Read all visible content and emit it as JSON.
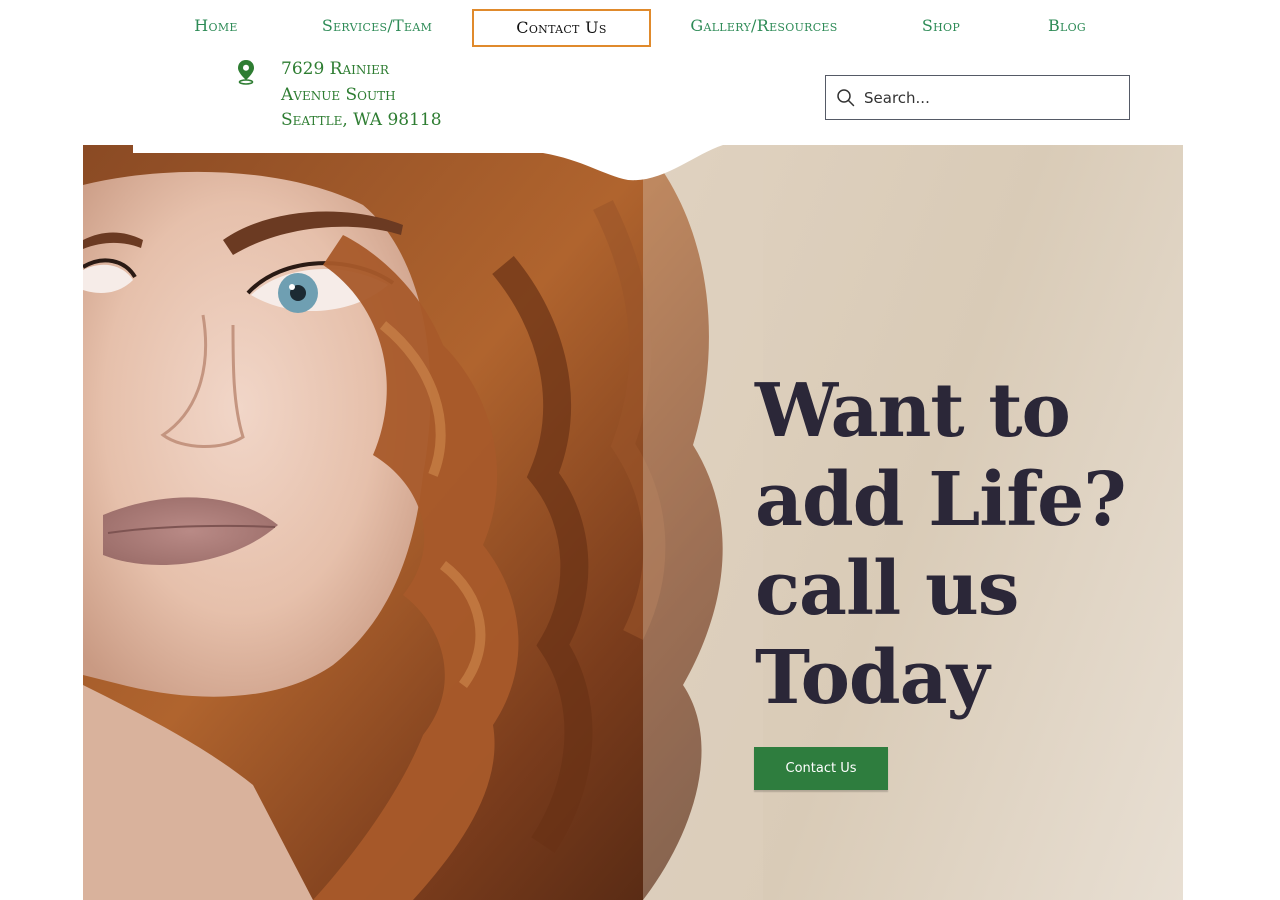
{
  "nav": {
    "items": [
      {
        "label": "Home"
      },
      {
        "label": "Services/Team"
      },
      {
        "label": "Contact Us"
      },
      {
        "label": "Gallery/Resources"
      },
      {
        "label": "Shop"
      },
      {
        "label": "Blog"
      }
    ],
    "active_index": 2,
    "text_color": "#2e8b57",
    "active_border_color": "#e08a2c"
  },
  "address": {
    "icon": "map-pin-icon",
    "lines": [
      "7629 Rainier",
      "Avenue South",
      "Seattle, WA 98118"
    ],
    "color": "#2e7d32"
  },
  "search": {
    "icon": "search-icon",
    "placeholder": "Search..."
  },
  "hero": {
    "image": "woman-with-curly-auburn-hair-photo",
    "headline_lines": [
      "Want to",
      "add Life?",
      "call us",
      "Today"
    ],
    "headline_color": "#2b2738",
    "cta_label": "Contact Us",
    "cta_color": "#2e7d3e"
  }
}
